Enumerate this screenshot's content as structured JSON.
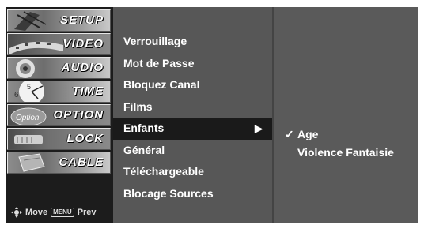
{
  "sidebar": {
    "tabs": [
      {
        "label": "SETUP",
        "icon": "satellite-dish-icon"
      },
      {
        "label": "VIDEO",
        "icon": "film-reel-icon"
      },
      {
        "label": "AUDIO",
        "icon": "speaker-icon"
      },
      {
        "label": "TIME",
        "icon": "clock-icon"
      },
      {
        "label": "OPTION",
        "icon": "option-tag-icon"
      },
      {
        "label": "LOCK",
        "icon": "keys-icon"
      },
      {
        "label": "CABLE",
        "icon": "cable-card-icon"
      }
    ],
    "footer": {
      "move": "Move",
      "menu_key": "MENU",
      "prev": "Prev"
    }
  },
  "menu": {
    "items": [
      "Verrouillage",
      "Mot de Passe",
      "Bloquez Canal",
      "Films",
      "Enfants",
      "Général",
      "Téléchargeable",
      "Blocage Sources"
    ],
    "selected_index": 4,
    "arrow": "▶"
  },
  "submenu": {
    "items": [
      {
        "label": "Age",
        "checked": true
      },
      {
        "label": "Violence Fantaisie",
        "checked": false
      }
    ],
    "check_glyph": "✓"
  },
  "colors": {
    "screen_bg": "#111111",
    "menu_panel": "#575757",
    "sub_panel": "#5a5a5a",
    "highlight": "#1a1a1a",
    "text": "#ffffff"
  }
}
